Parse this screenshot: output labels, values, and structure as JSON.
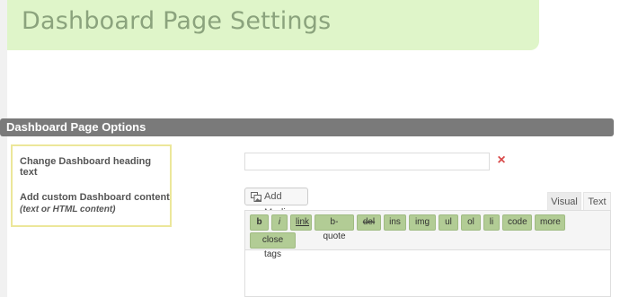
{
  "header": {
    "title": "Dashboard Page Settings"
  },
  "section": {
    "title": "Dashboard Page Options"
  },
  "options": {
    "heading_label": "Change Dashboard heading text",
    "content_label": "Add custom Dashboard content",
    "content_sublabel": "(text or HTML content)"
  },
  "heading_input": {
    "value": "",
    "placeholder": ""
  },
  "clear_icon": "×",
  "media": {
    "add_label": "Add Media"
  },
  "editor_tabs": {
    "visual": "Visual",
    "text": "Text",
    "active": "text"
  },
  "quicktags": [
    "b",
    "i",
    "link",
    "b-quote",
    "del",
    "ins",
    "img",
    "ul",
    "ol",
    "li",
    "code",
    "more",
    "close tags"
  ],
  "colors": {
    "banner_bg": "#dff5c9",
    "banner_text": "#8ba37d",
    "section_bar": "#7a7a7a",
    "options_border": "#ece79a",
    "quicktag_bg": "#b2cc95",
    "clear_icon": "#d94b4b"
  }
}
